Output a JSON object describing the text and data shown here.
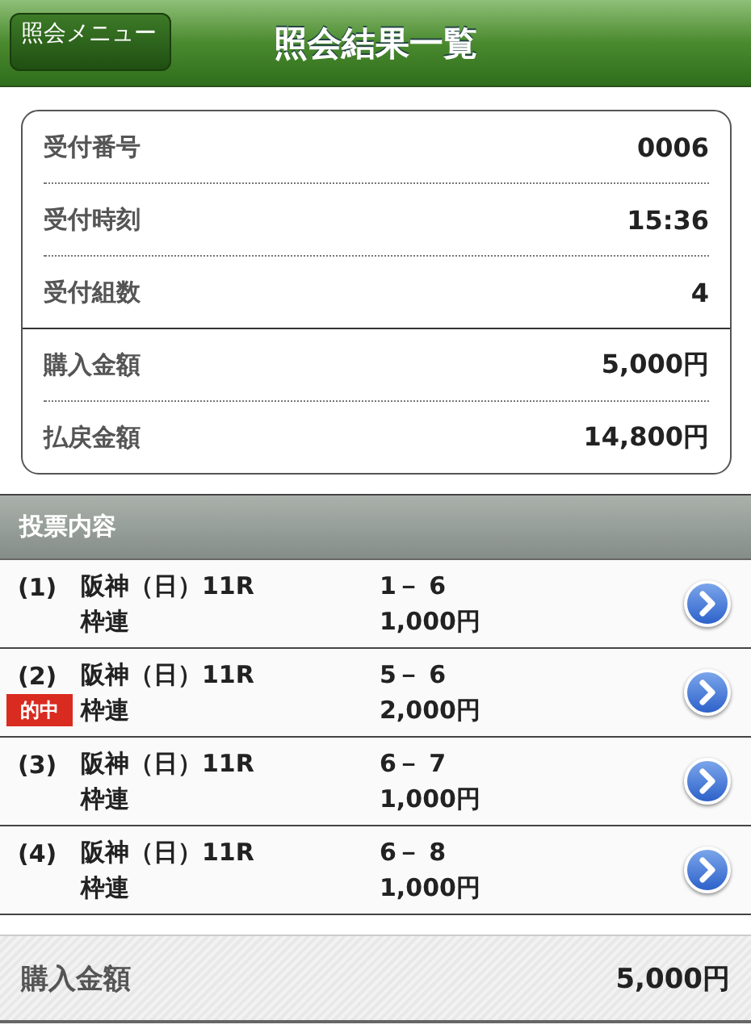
{
  "nav_bar": {
    "back_button": "照会メニュー",
    "title": "照会結果一覧"
  },
  "summary_groups": [
    [
      {
        "label": "受付番号",
        "value": "0006"
      },
      {
        "label": "受付時刻",
        "value": "15:36"
      },
      {
        "label": "受付組数",
        "value": "4"
      }
    ],
    [
      {
        "label": "購入金額",
        "value": "5,000円"
      },
      {
        "label": "払戻金額",
        "value": "14,800円"
      }
    ]
  ],
  "bets_header": "投票内容",
  "bets": [
    {
      "number": "(1)",
      "race": "阪神（日）11R",
      "bet_type": "枠連",
      "combination": "1－ 6",
      "amount": "1,000円"
    },
    {
      "number": "(2)",
      "badge": "的中",
      "race": "阪神（日）11R",
      "bet_type": "枠連",
      "combination": "5－ 6",
      "amount": "2,000円"
    },
    {
      "number": "(3)",
      "race": "阪神（日）11R",
      "bet_type": "枠連",
      "combination": "6－ 7",
      "amount": "1,000円"
    },
    {
      "number": "(4)",
      "race": "阪神（日）11R",
      "bet_type": "枠連",
      "combination": "6－ 8",
      "amount": "1,000円"
    }
  ],
  "footer": {
    "label": "購入金額",
    "value": "5,000円"
  }
}
